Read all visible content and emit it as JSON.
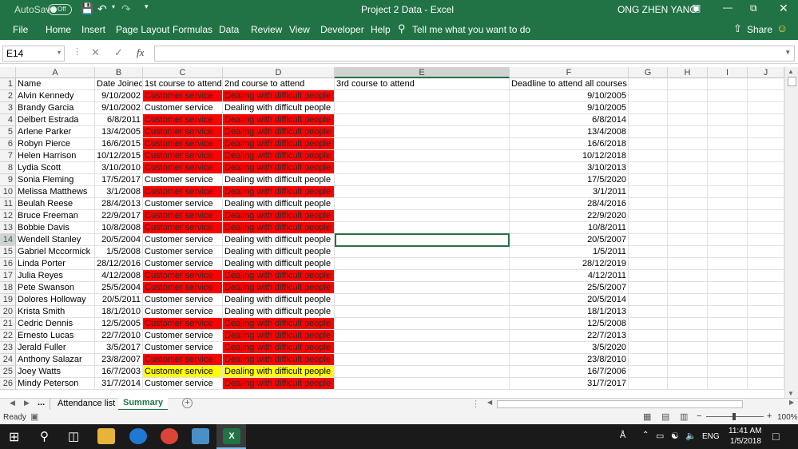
{
  "titlebar": {
    "autosave": "AutoSave",
    "autosave_state": "Off",
    "title": "Project 2 Data  -  Excel",
    "user": "ONG ZHEN YANG"
  },
  "ribbon": {
    "tabs": [
      "File",
      "Home",
      "Insert",
      "Page Layout",
      "Formulas",
      "Data",
      "Review",
      "View",
      "Developer",
      "Help"
    ],
    "tell_me": "Tell me what you want to do",
    "share": "Share"
  },
  "formula_bar": {
    "name_box": "E14",
    "fx": "fx",
    "content": ""
  },
  "columns": [
    "A",
    "B",
    "C",
    "D",
    "E",
    "F",
    "G",
    "H",
    "I",
    "J"
  ],
  "rows": [
    {
      "n": "1",
      "a": "Name",
      "b": "Date Joined",
      "c": "1st course to attend",
      "d": "2nd course to attend",
      "e": "3rd course to attend",
      "f": "Deadline to attend all courses",
      "cs": "",
      "ds": ""
    },
    {
      "n": "2",
      "a": "Alvin Kennedy",
      "b": "9/10/2002",
      "c": "Customer service",
      "d": "Dealing with difficult people",
      "e": "",
      "f": "9/10/2005",
      "cs": "red",
      "ds": "red"
    },
    {
      "n": "3",
      "a": "Brandy Garcia",
      "b": "9/10/2002",
      "c": "Customer service",
      "d": "Dealing with difficult people",
      "e": "",
      "f": "9/10/2005",
      "cs": "",
      "ds": ""
    },
    {
      "n": "4",
      "a": "Delbert Estrada",
      "b": "6/8/2011",
      "c": "Customer service",
      "d": "Dealing with difficult people",
      "e": "",
      "f": "6/8/2014",
      "cs": "red",
      "ds": "red"
    },
    {
      "n": "5",
      "a": "Arlene Parker",
      "b": "13/4/2005",
      "c": "Customer service",
      "d": "Dealing with difficult people",
      "e": "",
      "f": "13/4/2008",
      "cs": "red",
      "ds": "red"
    },
    {
      "n": "6",
      "a": "Robyn Pierce",
      "b": "16/6/2015",
      "c": "Customer service",
      "d": "Dealing with difficult people",
      "e": "",
      "f": "16/6/2018",
      "cs": "red",
      "ds": "red"
    },
    {
      "n": "7",
      "a": "Helen Harrison",
      "b": "10/12/2015",
      "c": "Customer service",
      "d": "Dealing with difficult people",
      "e": "",
      "f": "10/12/2018",
      "cs": "red",
      "ds": "red"
    },
    {
      "n": "8",
      "a": "Lydia Scott",
      "b": "3/10/2010",
      "c": "Customer service",
      "d": "Dealing with difficult people",
      "e": "",
      "f": "3/10/2013",
      "cs": "red",
      "ds": "red"
    },
    {
      "n": "9",
      "a": "Sonia Fleming",
      "b": "17/5/2017",
      "c": "Customer service",
      "d": "Dealing with difficult people",
      "e": "",
      "f": "17/5/2020",
      "cs": "",
      "ds": ""
    },
    {
      "n": "10",
      "a": "Melissa Matthews",
      "b": "3/1/2008",
      "c": "Customer service",
      "d": "Dealing with difficult people",
      "e": "",
      "f": "3/1/2011",
      "cs": "red",
      "ds": "red"
    },
    {
      "n": "11",
      "a": "Beulah Reese",
      "b": "28/4/2013",
      "c": "Customer service",
      "d": "Dealing with difficult people",
      "e": "",
      "f": "28/4/2016",
      "cs": "",
      "ds": ""
    },
    {
      "n": "12",
      "a": "Bruce Freeman",
      "b": "22/9/2017",
      "c": "Customer service",
      "d": "Dealing with difficult people",
      "e": "",
      "f": "22/9/2020",
      "cs": "red",
      "ds": "red"
    },
    {
      "n": "13",
      "a": "Bobbie Davis",
      "b": "10/8/2008",
      "c": "Customer service",
      "d": "Dealing with difficult people",
      "e": "",
      "f": "10/8/2011",
      "cs": "red",
      "ds": "red"
    },
    {
      "n": "14",
      "a": "Wendell Stanley",
      "b": "20/5/2004",
      "c": "Customer service",
      "d": "Dealing with difficult people",
      "e": "",
      "f": "20/5/2007",
      "cs": "",
      "ds": ""
    },
    {
      "n": "15",
      "a": "Gabriel Mccormick",
      "b": "1/5/2008",
      "c": "Customer service",
      "d": "Dealing with difficult people",
      "e": "",
      "f": "1/5/2011",
      "cs": "",
      "ds": ""
    },
    {
      "n": "16",
      "a": "Linda Porter",
      "b": "28/12/2016",
      "c": "Customer service",
      "d": "Dealing with difficult people",
      "e": "",
      "f": "28/12/2019",
      "cs": "",
      "ds": ""
    },
    {
      "n": "17",
      "a": "Julia Reyes",
      "b": "4/12/2008",
      "c": "Customer service",
      "d": "Dealing with difficult people",
      "e": "",
      "f": "4/12/2011",
      "cs": "red",
      "ds": "red"
    },
    {
      "n": "18",
      "a": "Pete Swanson",
      "b": "25/5/2004",
      "c": "Customer service",
      "d": "Dealing with difficult people",
      "e": "",
      "f": "25/5/2007",
      "cs": "red",
      "ds": "red"
    },
    {
      "n": "19",
      "a": "Dolores Holloway",
      "b": "20/5/2011",
      "c": "Customer service",
      "d": "Dealing with difficult people",
      "e": "",
      "f": "20/5/2014",
      "cs": "",
      "ds": ""
    },
    {
      "n": "20",
      "a": "Krista Smith",
      "b": "18/1/2010",
      "c": "Customer service",
      "d": "Dealing with difficult people",
      "e": "",
      "f": "18/1/2013",
      "cs": "",
      "ds": ""
    },
    {
      "n": "21",
      "a": "Cedric Dennis",
      "b": "12/5/2005",
      "c": "Customer service",
      "d": "Dealing with difficult people",
      "e": "",
      "f": "12/5/2008",
      "cs": "red",
      "ds": "red"
    },
    {
      "n": "22",
      "a": "Ernesto Lucas",
      "b": "22/7/2010",
      "c": "Customer service",
      "d": "Dealing with difficult people",
      "e": "",
      "f": "22/7/2013",
      "cs": "",
      "ds": "red"
    },
    {
      "n": "23",
      "a": "Jerald Fuller",
      "b": "3/5/2017",
      "c": "Customer service",
      "d": "Dealing with difficult people",
      "e": "",
      "f": "3/5/2020",
      "cs": "",
      "ds": "red"
    },
    {
      "n": "24",
      "a": "Anthony Salazar",
      "b": "23/8/2007",
      "c": "Customer service",
      "d": "Dealing with difficult people",
      "e": "",
      "f": "23/8/2010",
      "cs": "red",
      "ds": "red"
    },
    {
      "n": "25",
      "a": "Joey Watts",
      "b": "16/7/2003",
      "c": "Customer service",
      "d": "Dealing with difficult people",
      "e": "",
      "f": "16/7/2006",
      "cs": "yel",
      "ds": "yel"
    },
    {
      "n": "26",
      "a": "Mindy Peterson",
      "b": "31/7/2014",
      "c": "Customer service",
      "d": "Dealing with difficult people",
      "e": "",
      "f": "31/7/2017",
      "cs": "",
      "ds": "red"
    }
  ],
  "sheet_tabs": {
    "ellipsis": "...",
    "tabs": [
      "Attendance list",
      "Summary"
    ],
    "active": "Summary"
  },
  "status": {
    "ready": "Ready",
    "zoom": "100%"
  },
  "taskbar": {
    "time": "11:41 AM",
    "date": "1/5/2018",
    "lang": "ENG"
  },
  "colors": {
    "excel_green": "#217346",
    "red_fill": "#ff0000",
    "yellow_fill": "#ffff00"
  }
}
